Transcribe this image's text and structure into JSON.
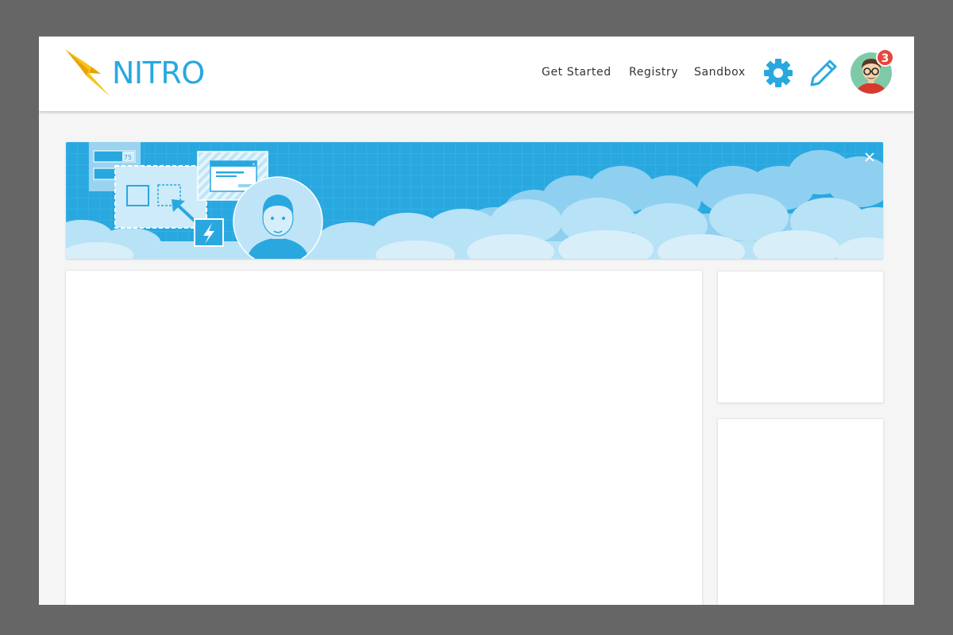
{
  "brand": {
    "name": "NITRO",
    "accent_color": "#29a8e0",
    "bolt_colors": [
      "#f7c31b",
      "#e6a400"
    ]
  },
  "nav": {
    "items": [
      {
        "label": "Get Started"
      },
      {
        "label": "Registry"
      },
      {
        "label": "Sandbox"
      }
    ]
  },
  "toolbar": {
    "settings_icon": "gear-icon",
    "edit_icon": "pencil-icon"
  },
  "user": {
    "avatar": "avatar-man-glasses",
    "notification_count": "3"
  },
  "banner": {
    "illustration": "developer-with-ui-components-and-clouds",
    "background_color": "#29a8e0",
    "badge_value": "75",
    "close_icon": "close-icon"
  },
  "colors": {
    "page_background": "#f5f5f5",
    "outer_frame": "#666666",
    "notification_badge": "#e8453c"
  }
}
